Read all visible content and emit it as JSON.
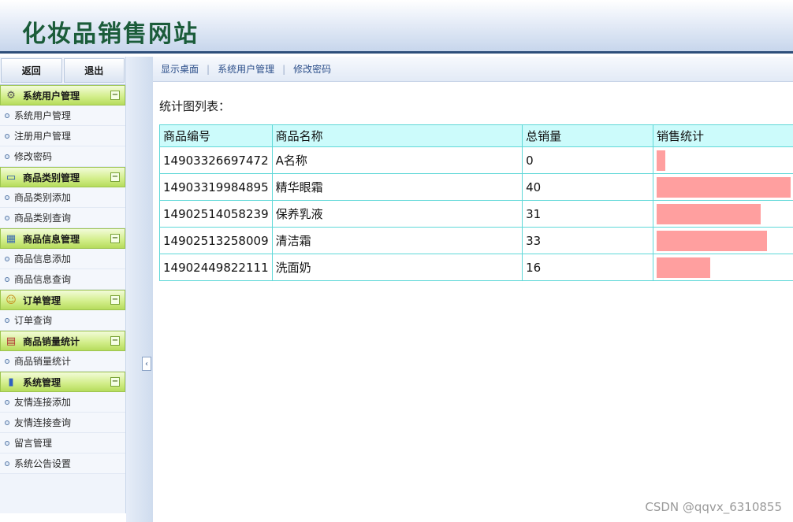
{
  "header": {
    "title": "化妆品销售网站"
  },
  "sidebar": {
    "buttons": {
      "back": "返回",
      "logout": "退出"
    },
    "groups": [
      {
        "title": "系统用户管理",
        "icon": "gear-icon",
        "items": [
          "系统用户管理",
          "注册用户管理",
          "修改密码"
        ]
      },
      {
        "title": "商品类别管理",
        "icon": "monitor-icon",
        "items": [
          "商品类别添加",
          "商品类别查询"
        ]
      },
      {
        "title": "商品信息管理",
        "icon": "grid-icon",
        "items": [
          "商品信息添加",
          "商品信息查询"
        ]
      },
      {
        "title": "订单管理",
        "icon": "user-icon",
        "items": [
          "订单查询"
        ]
      },
      {
        "title": "商品销量统计",
        "icon": "calendar-icon",
        "items": [
          "商品销量统计"
        ]
      },
      {
        "title": "系统管理",
        "icon": "bar-chart-icon",
        "items": [
          "友情连接添加",
          "友情连接查询",
          "留言管理",
          "系统公告设置"
        ]
      }
    ],
    "collapse_symbol": "−"
  },
  "toolbar": {
    "links": [
      "显示桌面",
      "系统用户管理",
      "修改密码"
    ],
    "separator": "|"
  },
  "main": {
    "list_title": "统计图列表：",
    "columns": [
      "商品编号",
      "商品名称",
      "总销量",
      "销售统计"
    ],
    "rows": [
      {
        "id": "14903326697472",
        "name": "A名称",
        "sales": 0
      },
      {
        "id": "14903319984895",
        "name": "精华眼霜",
        "sales": 40
      },
      {
        "id": "14902514058239",
        "name": "保养乳液",
        "sales": 31
      },
      {
        "id": "14902513258009",
        "name": "清洁霜",
        "sales": 33
      },
      {
        "id": "14902449822111",
        "name": "洗面奶",
        "sales": 16
      }
    ]
  },
  "colors": {
    "bar": "#ff9f9f",
    "table_border": "#5fd8d8",
    "header_bg": "#ccfbfb",
    "title": "#1b5c3a"
  },
  "watermark": "CSDN @qqvx_6310855"
}
